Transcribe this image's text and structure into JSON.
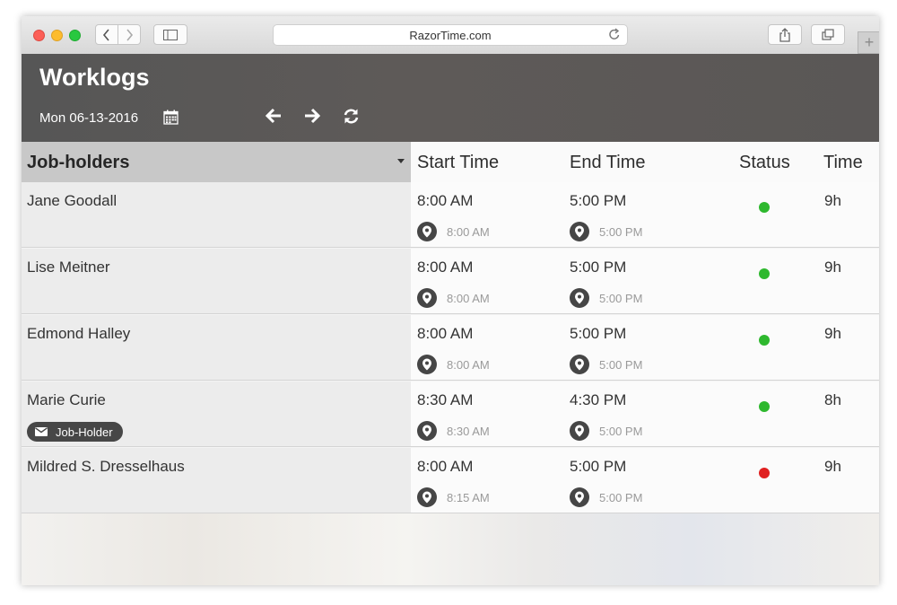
{
  "browser": {
    "url": "RazorTime.com",
    "new_tab": "+"
  },
  "header": {
    "title": "Worklogs",
    "date": "Mon 06-13-2016"
  },
  "table": {
    "columns": {
      "job_holders": "Job-holders",
      "start_time": "Start Time",
      "end_time": "End Time",
      "status": "Status",
      "time": "Time"
    },
    "rows": [
      {
        "name": "Jane Goodall",
        "start": "8:00 AM",
        "start_actual": "8:00 AM",
        "end": "5:00 PM",
        "end_actual": "5:00 PM",
        "status": "green",
        "total": "9h"
      },
      {
        "name": "Lise Meitner",
        "start": "8:00 AM",
        "start_actual": "8:00 AM",
        "end": "5:00 PM",
        "end_actual": "5:00 PM",
        "status": "green",
        "total": "9h"
      },
      {
        "name": "Edmond Halley",
        "start": "8:00 AM",
        "start_actual": "8:00 AM",
        "end": "5:00 PM",
        "end_actual": "5:00 PM",
        "status": "green",
        "total": "9h"
      },
      {
        "name": "Marie Curie",
        "tag": "Job-Holder",
        "start": "8:30 AM",
        "start_actual": "8:30 AM",
        "end": "4:30 PM",
        "end_actual": "5:00 PM",
        "status": "green",
        "total": "8h"
      },
      {
        "name": "Mildred S. Dresselhaus",
        "start": "8:00 AM",
        "start_actual": "8:15 AM",
        "end": "5:00 PM",
        "end_actual": "5:00 PM",
        "status": "red",
        "total": "9h"
      }
    ]
  },
  "colors": {
    "status_green": "#2eb82e",
    "status_red": "#e02020",
    "header_bg": "#5a5756"
  },
  "icons": [
    "back-icon",
    "forward-icon",
    "sidebar-icon",
    "reload-icon",
    "share-icon",
    "tabs-icon",
    "calendar-icon",
    "arrow-left-icon",
    "arrow-right-icon",
    "refresh-icon",
    "location-pin-icon",
    "envelope-icon"
  ]
}
